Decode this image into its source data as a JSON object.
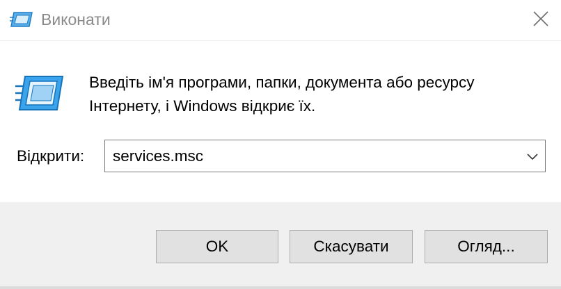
{
  "window": {
    "title": "Виконати",
    "app_icon": "run-icon",
    "close_icon": "close-icon"
  },
  "content": {
    "icon": "run-icon",
    "description": "Введіть ім'я програми, папки, документа або ресурсу Інтернету, і Windows відкриє їх.",
    "open_label": "Відкрити:",
    "open_value": "services.msc",
    "dropdown_icon": "chevron-down-icon"
  },
  "buttons": {
    "ok": "OK",
    "cancel": "Скасувати",
    "browse": "Огляд..."
  },
  "colors": {
    "title_text": "#8a8a8a",
    "footer_bg": "#f0f0f0",
    "button_bg": "#e1e1e1",
    "button_border": "#adadad",
    "icon_blue": "#2f9be6"
  }
}
